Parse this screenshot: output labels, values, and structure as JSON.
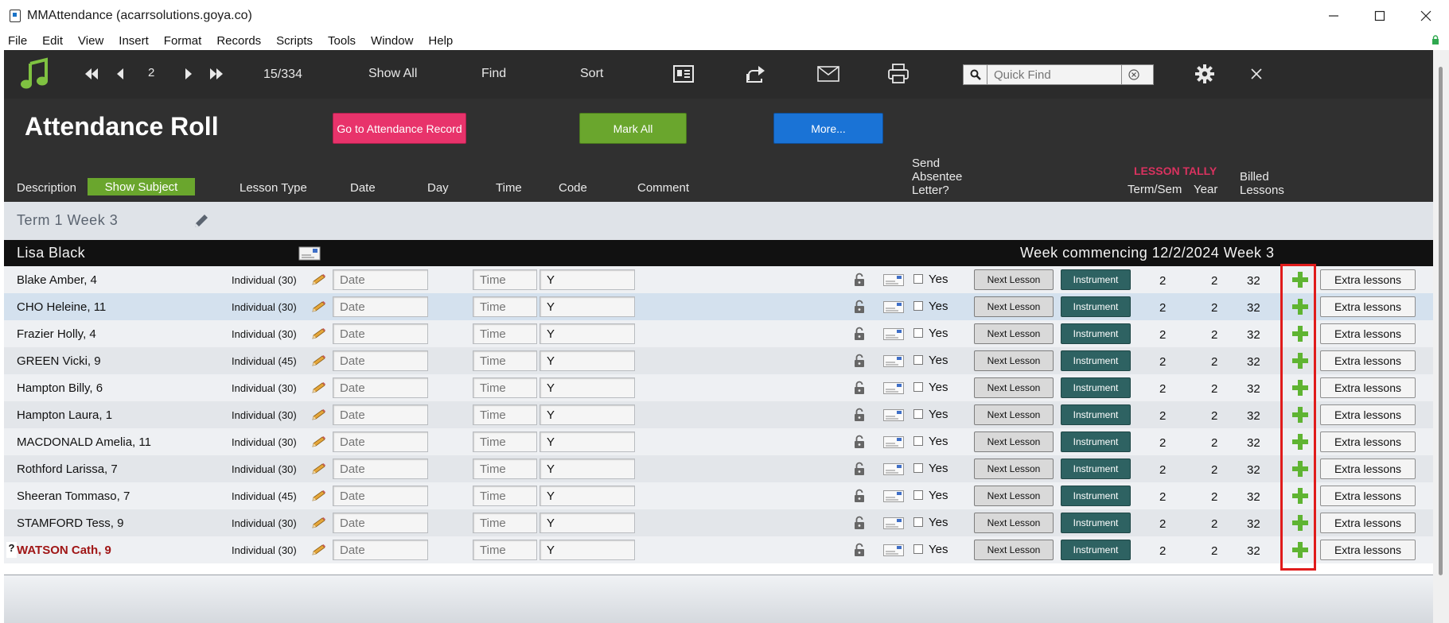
{
  "window": {
    "title": "MMAttendance (acarrsolutions.goya.co)"
  },
  "menu": [
    "File",
    "Edit",
    "View",
    "Insert",
    "Format",
    "Records",
    "Scripts",
    "Tools",
    "Window",
    "Help"
  ],
  "toolbar": {
    "record_number": "2",
    "record_count": "15/334",
    "show_all": "Show All",
    "find": "Find",
    "sort": "Sort",
    "quick_find_placeholder": "Quick Find"
  },
  "header": {
    "title": "Attendance Roll",
    "go_to_record": "Go to Attendance Record",
    "mark_all": "Mark All",
    "more": "More...",
    "show_subject": "Show Subject",
    "columns": {
      "description": "Description",
      "lesson_type": "Lesson Type",
      "date": "Date",
      "day": "Day",
      "time": "Time",
      "code": "Code",
      "comment": "Comment",
      "send_letter_1": "Send",
      "send_letter_2": "Absentee",
      "send_letter_3": "Letter?",
      "lesson_tally": "LESSON TALLY",
      "term_sem": "Term/Sem",
      "year": "Year",
      "billed_1": "Billed",
      "billed_2": "Lessons"
    }
  },
  "term": "Term 1 Week 3",
  "teacher": {
    "name": "Lisa Black",
    "week": "Week commencing 12/2/2024  Week 3"
  },
  "row_labels": {
    "date_placeholder": "Date",
    "time_placeholder": "Time",
    "yes": "Yes",
    "next_lesson": "Next Lesson",
    "instrument": "Instrument",
    "extra_lessons": "Extra lessons",
    "flag": "?"
  },
  "rows": [
    {
      "student": "Blake Amber, 4",
      "lesson_type": "Individual (30)",
      "code": "Y",
      "term": "2",
      "year": "2",
      "billed": "32"
    },
    {
      "student": "CHO Heleine, 11",
      "lesson_type": "Individual (30)",
      "code": "Y",
      "term": "2",
      "year": "2",
      "billed": "32"
    },
    {
      "student": "Frazier Holly, 4",
      "lesson_type": "Individual (30)",
      "code": "Y",
      "term": "2",
      "year": "2",
      "billed": "32"
    },
    {
      "student": "GREEN Vicki, 9",
      "lesson_type": "Individual (45)",
      "code": "Y",
      "term": "2",
      "year": "2",
      "billed": "32"
    },
    {
      "student": "Hampton Billy, 6",
      "lesson_type": "Individual (30)",
      "code": "Y",
      "term": "2",
      "year": "2",
      "billed": "32"
    },
    {
      "student": "Hampton Laura, 1",
      "lesson_type": "Individual (30)",
      "code": "Y",
      "term": "2",
      "year": "2",
      "billed": "32"
    },
    {
      "student": "MACDONALD Amelia, 11",
      "lesson_type": "Individual (30)",
      "code": "Y",
      "term": "2",
      "year": "2",
      "billed": "32"
    },
    {
      "student": "Rothford Larissa, 7",
      "lesson_type": "Individual (30)",
      "code": "Y",
      "term": "2",
      "year": "2",
      "billed": "32"
    },
    {
      "student": "Sheeran Tommaso, 7",
      "lesson_type": "Individual (45)",
      "code": "Y",
      "term": "2",
      "year": "2",
      "billed": "32"
    },
    {
      "student": "STAMFORD Tess, 9",
      "lesson_type": "Individual (30)",
      "code": "Y",
      "term": "2",
      "year": "2",
      "billed": "32"
    },
    {
      "student": "WATSON Cath, 9",
      "lesson_type": "Individual (30)",
      "code": "Y",
      "term": "2",
      "year": "2",
      "billed": "32"
    }
  ],
  "colors": {
    "go_to_record": "#e8336b",
    "mark_all": "#6aa62d",
    "more": "#1a73d6",
    "lesson_tally": "#d9325f",
    "flagged_student": "#a01616",
    "highlight": "#e01b1b"
  }
}
